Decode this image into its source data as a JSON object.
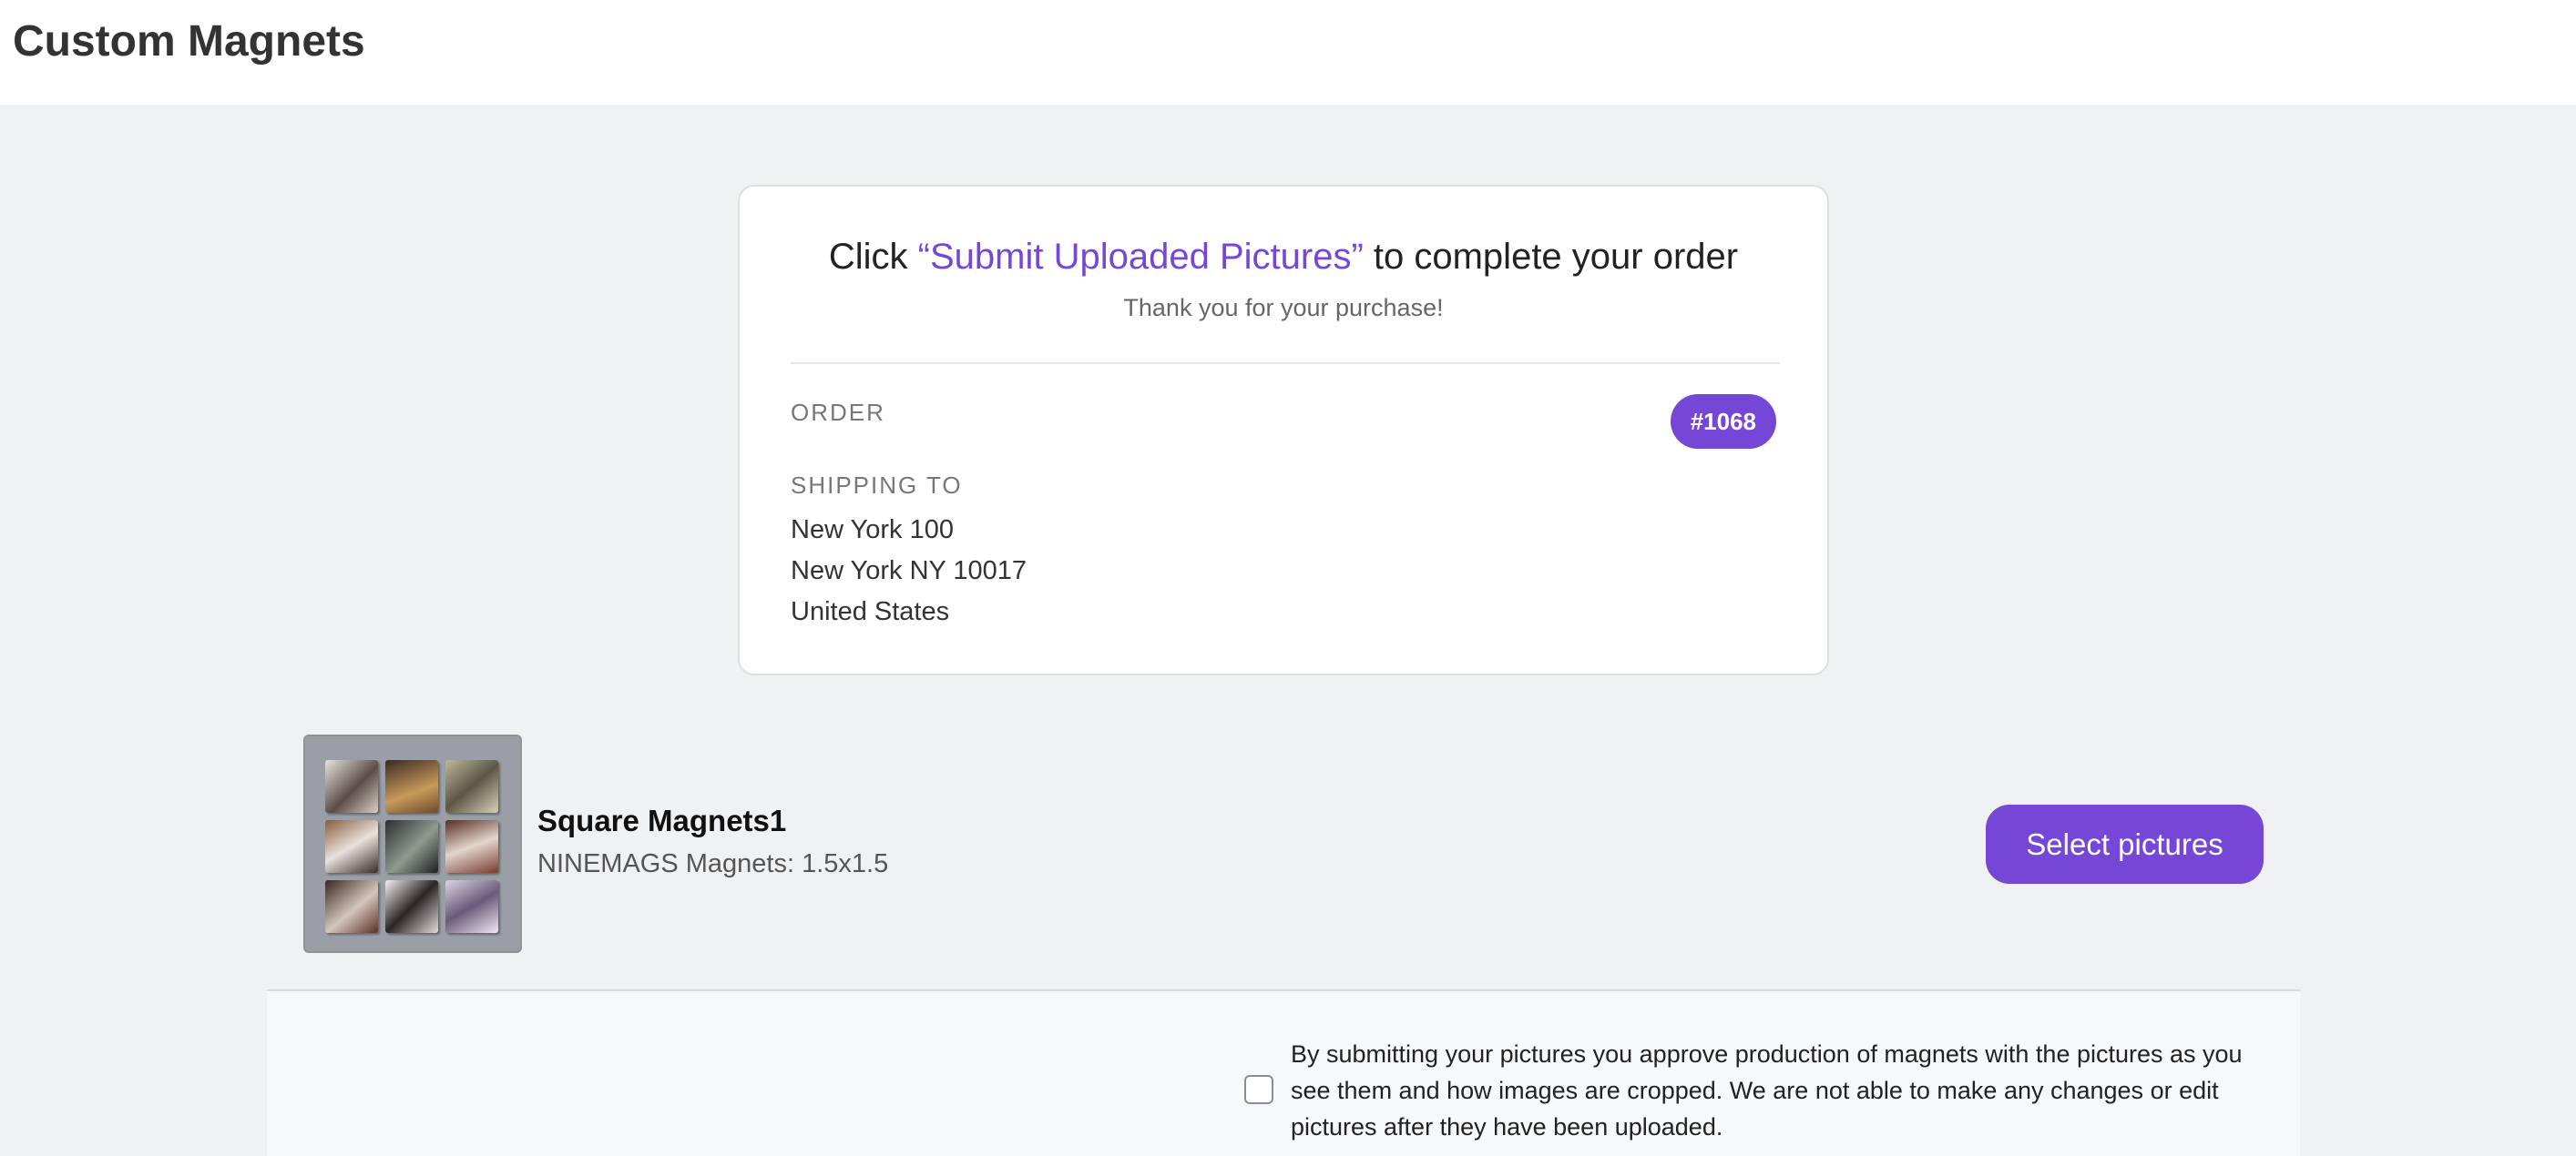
{
  "app": {
    "title": "Custom Magnets"
  },
  "order_card": {
    "headline_prefix": "Click ",
    "headline_highlight": "“Submit Uploaded Pictures”",
    "headline_suffix": " to complete your order",
    "thank_you": "Thank you for your purchase!",
    "order_label": "ORDER",
    "order_number": "#1068",
    "shipping_label": "SHIPPING TO",
    "address_line_1": "New York 100",
    "address_line_2": "New York NY 10017",
    "address_line_3": "United States"
  },
  "product": {
    "name": "Square Magnets1",
    "variant": "NINEMAGS Magnets: 1.5x1.5",
    "select_button_label": "Select pictures"
  },
  "consent": {
    "text": "By submitting your pictures you approve production of magnets with the pictures as you see them and how images are cropped. We are not able to make any changes or edit pictures after they have been uploaded.",
    "checked": false
  },
  "colors": {
    "accent": "#7646d6",
    "page_background": "#f0f1f3",
    "card_background": "#ffffff"
  }
}
